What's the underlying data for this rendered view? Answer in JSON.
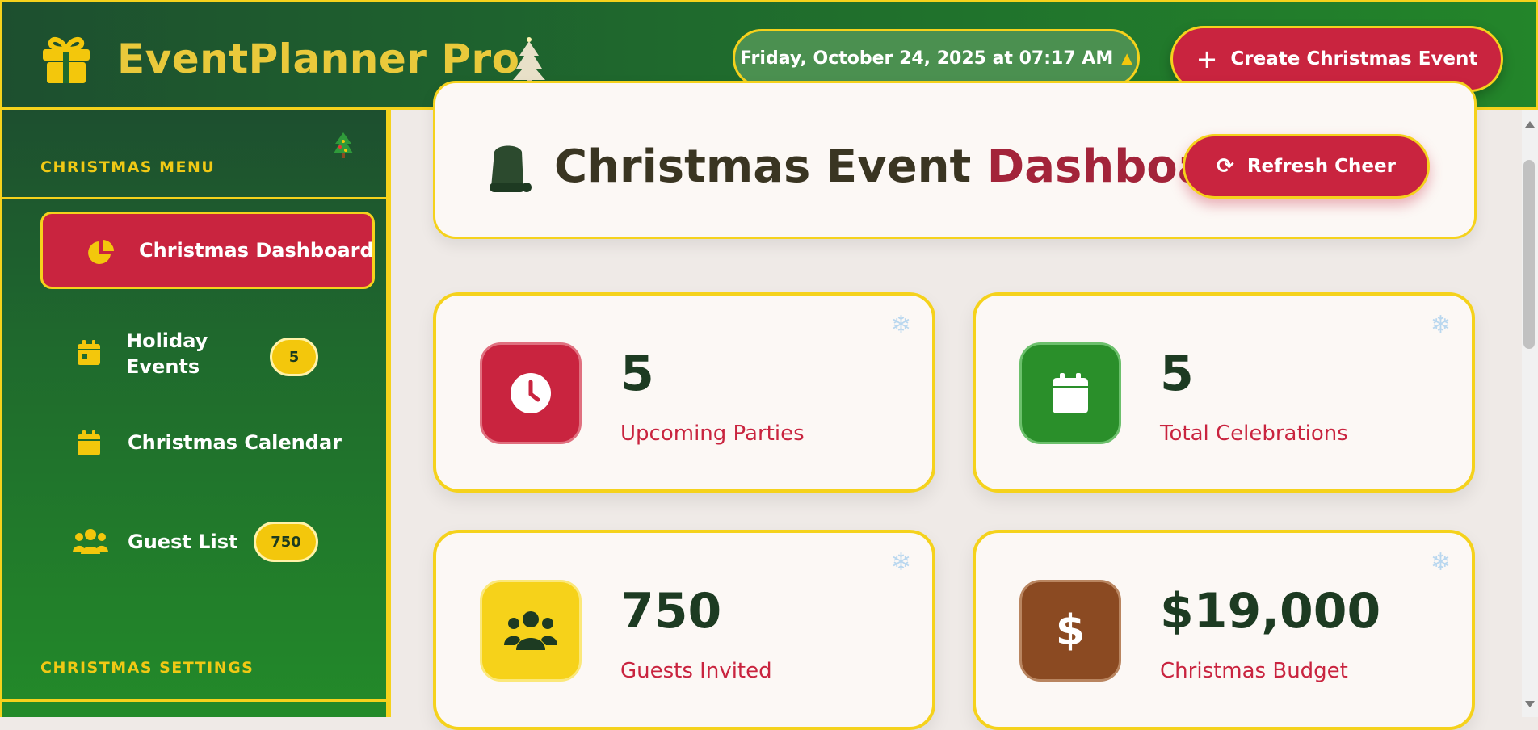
{
  "header": {
    "brand": "EventPlanner Pro",
    "datetime": "Friday, October 24, 2025 at 07:17 AM",
    "create_button": "Create Christmas Event"
  },
  "sidebar": {
    "menu_title": "CHRISTMAS MENU",
    "items": [
      {
        "label": "Christmas Dashboard",
        "icon": "pie-chart-icon",
        "active": true
      },
      {
        "label": "Holiday Events",
        "icon": "calendar-day-icon",
        "badge": "5"
      },
      {
        "label": "Christmas Calendar",
        "icon": "calendar-icon"
      },
      {
        "label": "Guest List",
        "icon": "users-icon",
        "badge": "750"
      }
    ],
    "settings_title": "CHRISTMAS SETTINGS"
  },
  "dashboard": {
    "title_part1": "Christmas Event",
    "title_part2": "Dashboard",
    "refresh_button": "Refresh Cheer"
  },
  "stats": [
    {
      "value": "5",
      "label": "Upcoming Parties",
      "icon": "clock-icon",
      "color": "#c9243f"
    },
    {
      "value": "5",
      "label": "Total Celebrations",
      "icon": "calendar-icon",
      "color": "#2a8f2a"
    },
    {
      "value": "750",
      "label": "Guests Invited",
      "icon": "users-icon",
      "color": "#f6d21a"
    },
    {
      "value": "$19,000",
      "label": "Christmas Budget",
      "icon": "dollar-icon",
      "color": "#8b4a22"
    }
  ],
  "colors": {
    "accent_red": "#c9243f",
    "accent_gold": "#f5d21c",
    "green": "#1f6a2d"
  }
}
